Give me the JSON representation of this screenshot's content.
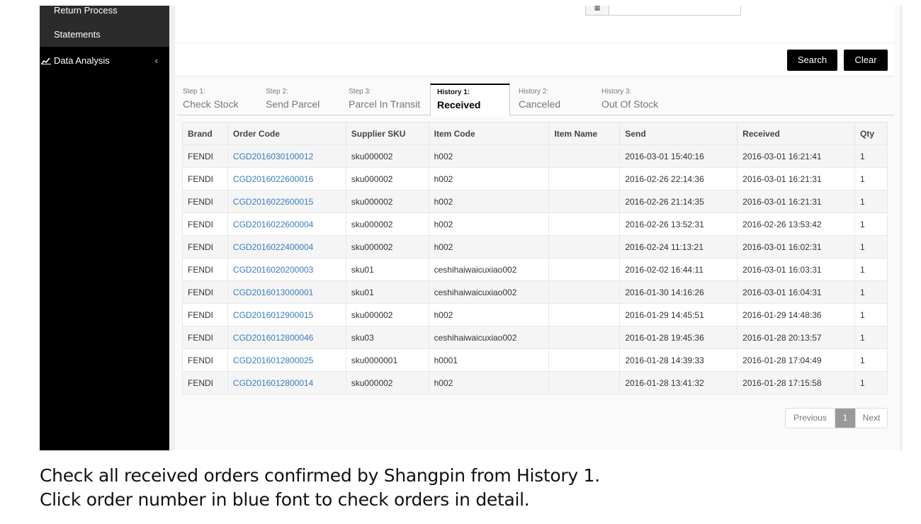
{
  "sidebar": {
    "items": [
      {
        "label": "Return Process"
      },
      {
        "label": "Statements"
      },
      {
        "label": "Data Analysis",
        "icon": "line-chart-icon",
        "chevron": "‹"
      }
    ]
  },
  "filter": {
    "calendar_icon": "▦",
    "search_label": "Search",
    "clear_label": "Clear"
  },
  "tabs": [
    {
      "step": "Step 1:",
      "name": "Check Stock"
    },
    {
      "step": "Step 2:",
      "name": "Send Parcel"
    },
    {
      "step": "Step 3:",
      "name": "Parcel In Transit"
    },
    {
      "step": "History 1:",
      "name": "Received",
      "active": true
    },
    {
      "step": "History 2:",
      "name": "Canceled"
    },
    {
      "step": "History 3:",
      "name": "Out Of Stock"
    }
  ],
  "table": {
    "columns": [
      "Brand",
      "Order Code",
      "Supplier SKU",
      "Item Code",
      "Item Name",
      "Send",
      "Received",
      "Qty"
    ],
    "rows": [
      [
        "FENDI",
        "CGD2016030100012",
        "sku000002",
        "h002",
        "",
        "2016-03-01 15:40:16",
        "2016-03-01 16:21:41",
        "1"
      ],
      [
        "FENDI",
        "CGD2016022600016",
        "sku000002",
        "h002",
        "",
        "2016-02-26 22:14:36",
        "2016-03-01 16:21:31",
        "1"
      ],
      [
        "FENDI",
        "CGD2016022600015",
        "sku000002",
        "h002",
        "",
        "2016-02-26 21:14:35",
        "2016-03-01 16:21:31",
        "1"
      ],
      [
        "FENDI",
        "CGD2016022600004",
        "sku000002",
        "h002",
        "",
        "2016-02-26 13:52:31",
        "2016-02-26 13:53:42",
        "1"
      ],
      [
        "FENDI",
        "CGD2016022400004",
        "sku000002",
        "h002",
        "",
        "2016-02-24 11:13:21",
        "2016-03-01 16:02:31",
        "1"
      ],
      [
        "FENDI",
        "CGD2016020200003",
        "sku01",
        "ceshihaiwaicuxiao002",
        "",
        "2016-02-02 16:44:11",
        "2016-03-01 16:03:31",
        "1"
      ],
      [
        "FENDI",
        "CGD2016013000001",
        "sku01",
        "ceshihaiwaicuxiao002",
        "",
        "2016-01-30 14:16:26",
        "2016-03-01 16:04:31",
        "1"
      ],
      [
        "FENDI",
        "CGD2016012900015",
        "sku000002",
        "h002",
        "",
        "2016-01-29 14:45:51",
        "2016-01-29 14:48:36",
        "1"
      ],
      [
        "FENDI",
        "CGD2016012800046",
        "sku03",
        "ceshihaiwaicuxiao002",
        "",
        "2016-01-28 19:45:36",
        "2016-01-28 20:13:57",
        "1"
      ],
      [
        "FENDI",
        "CGD2016012800025",
        "sku0000001",
        "h0001",
        "",
        "2016-01-28 14:39:33",
        "2016-01-28 17:04:49",
        "1"
      ],
      [
        "FENDI",
        "CGD2016012800014",
        "sku000002",
        "h002",
        "",
        "2016-01-28 13:41:32",
        "2016-01-28 17:15:58",
        "1"
      ]
    ]
  },
  "pagination": {
    "previous": "Previous",
    "current": "1",
    "next": "Next"
  },
  "caption": {
    "line1": "Check all received orders confirmed by Shangpin from History 1.",
    "line2": "Click order number in blue font to check orders in detail."
  },
  "colors": {
    "sidebar_bg": "#000000",
    "button_bg": "#000000",
    "link": "#3a7bbf",
    "pager_active": "#999999"
  }
}
